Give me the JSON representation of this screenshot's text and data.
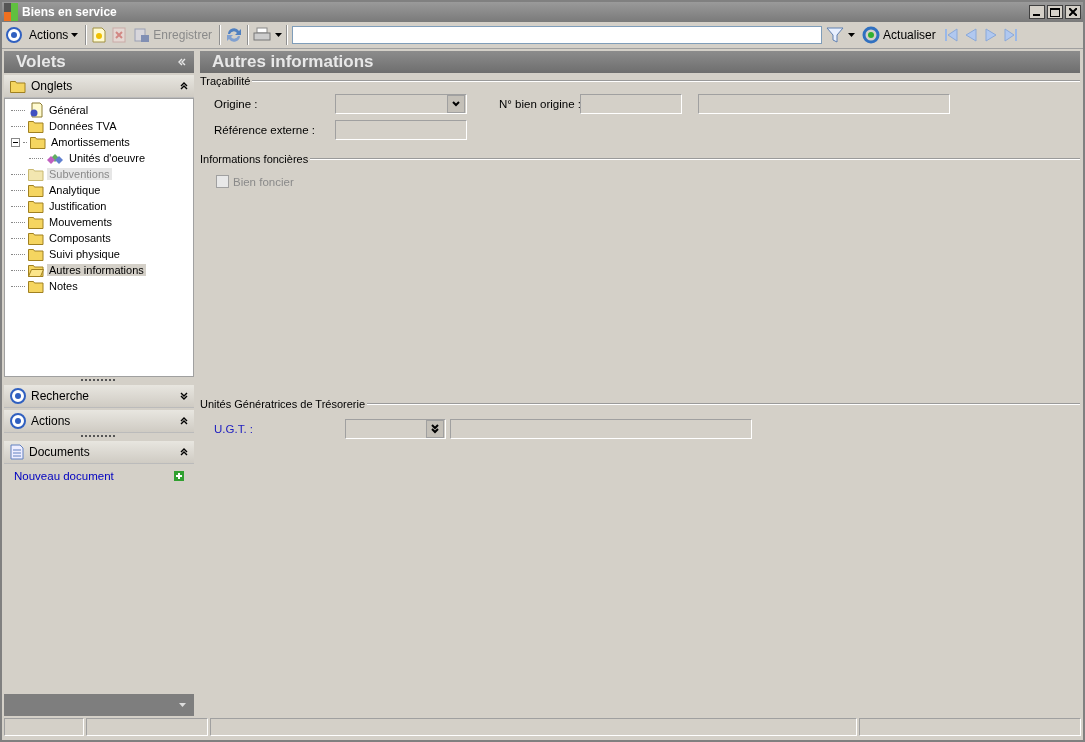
{
  "window": {
    "title": "Biens en service"
  },
  "toolbar": {
    "actions_label": "Actions",
    "save": {
      "label": "Enregistrer",
      "disabled": true
    },
    "delete_disabled": true,
    "refresh_label": "Actualiser"
  },
  "sidebar": {
    "title": "Volets",
    "tabs_panel": {
      "title": "Onglets",
      "expanded": true,
      "items": [
        {
          "label": "Général",
          "kind": "page",
          "selected": false,
          "disabled": false
        },
        {
          "label": "Données TVA",
          "kind": "folder",
          "selected": false,
          "disabled": false
        },
        {
          "label": "Amortissements",
          "kind": "folder",
          "selected": false,
          "disabled": false,
          "expanded": true,
          "children": [
            {
              "label": "Unités d'oeuvre",
              "kind": "item",
              "selected": false,
              "disabled": false
            }
          ]
        },
        {
          "label": "Subventions",
          "kind": "folder",
          "selected": false,
          "disabled": true
        },
        {
          "label": "Analytique",
          "kind": "folder",
          "selected": false,
          "disabled": false
        },
        {
          "label": "Justification",
          "kind": "folder",
          "selected": false,
          "disabled": false
        },
        {
          "label": "Mouvements",
          "kind": "folder",
          "selected": false,
          "disabled": false
        },
        {
          "label": "Composants",
          "kind": "folder",
          "selected": false,
          "disabled": false
        },
        {
          "label": "Suivi physique",
          "kind": "folder",
          "selected": false,
          "disabled": false
        },
        {
          "label": "Autres informations",
          "kind": "folder",
          "selected": true,
          "disabled": false
        },
        {
          "label": "Notes",
          "kind": "folder",
          "selected": false,
          "disabled": false
        }
      ]
    },
    "panels": [
      {
        "title": "Recherche",
        "kind": "target",
        "expanded": false
      },
      {
        "title": "Actions",
        "kind": "target",
        "expanded": true
      },
      {
        "title": "Documents",
        "kind": "document",
        "expanded": true,
        "link": "Nouveau document"
      }
    ]
  },
  "main": {
    "title": "Autres informations",
    "tracabilite": {
      "title": "Traçabilité",
      "origine_label": "Origine :",
      "reference_label": "Référence externe :",
      "numero_label": "N° bien origine :"
    },
    "foncier": {
      "title": "Informations foncières",
      "checkbox": {
        "label": "Bien foncier",
        "checked": false,
        "disabled": true
      }
    },
    "ugt": {
      "title": "Unités Génératrices de Trésorerie",
      "label": "U.G.T. :"
    }
  }
}
